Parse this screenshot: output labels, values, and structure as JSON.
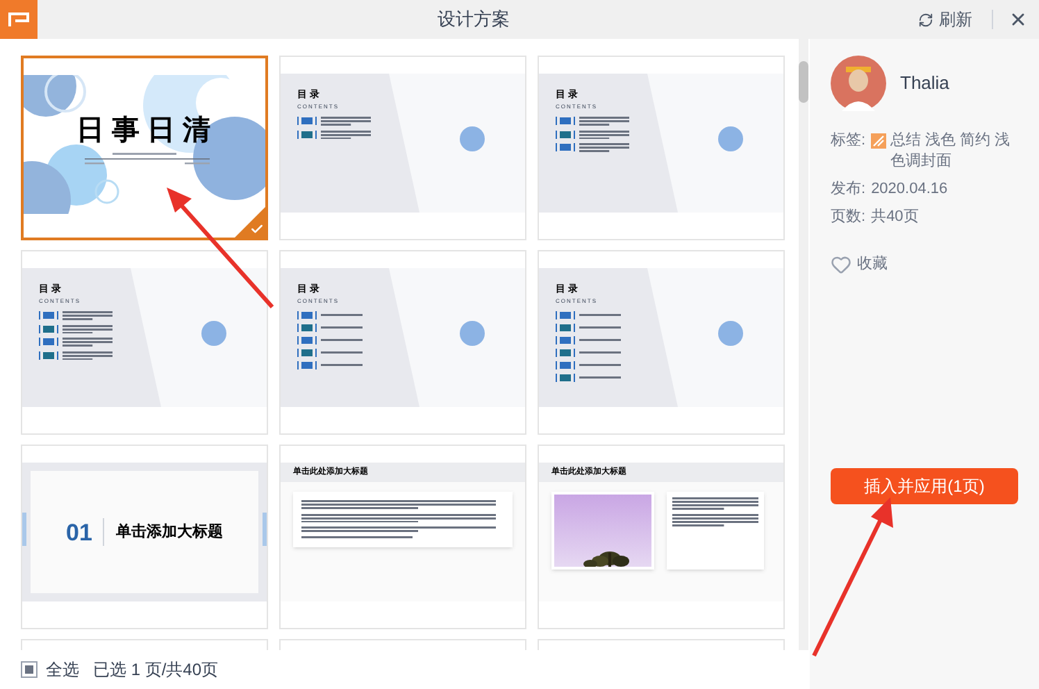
{
  "window": {
    "title": "设计方案",
    "refresh": "刷新"
  },
  "slides": [
    {
      "kind": "cover",
      "selected": true,
      "title": "日 事 日 清"
    },
    {
      "kind": "toc",
      "selected": false,
      "title": "目 录",
      "subtitle": "CONTENTS",
      "entries": [
        {
          "kind": "long"
        },
        {
          "kind": "long"
        }
      ]
    },
    {
      "kind": "toc",
      "selected": false,
      "title": "目 录",
      "subtitle": "CONTENTS",
      "entries": [
        {
          "kind": "long"
        },
        {
          "kind": "long"
        },
        {
          "kind": "long"
        }
      ]
    },
    {
      "kind": "toc",
      "selected": false,
      "title": "目 录",
      "subtitle": "CONTENTS",
      "entries": [
        {
          "kind": "long"
        },
        {
          "kind": "long"
        },
        {
          "kind": "long"
        },
        {
          "kind": "long"
        }
      ]
    },
    {
      "kind": "toc",
      "selected": false,
      "title": "目 录",
      "subtitle": "CONTENTS",
      "entries": [
        {
          "kind": "short"
        },
        {
          "kind": "short"
        },
        {
          "kind": "short"
        },
        {
          "kind": "short"
        },
        {
          "kind": "short"
        }
      ]
    },
    {
      "kind": "toc",
      "selected": false,
      "title": "目 录",
      "subtitle": "CONTENTS",
      "entries": [
        {
          "kind": "short"
        },
        {
          "kind": "short"
        },
        {
          "kind": "short"
        },
        {
          "kind": "short"
        },
        {
          "kind": "short"
        },
        {
          "kind": "short"
        }
      ]
    },
    {
      "kind": "section",
      "selected": false,
      "number": "01",
      "title": "单击添加大标题"
    },
    {
      "kind": "text",
      "selected": false,
      "title": "单击此处添加大标题"
    },
    {
      "selected": false,
      "title": "单击此处添加大标题"
    },
    {
      "kind": "cut-off",
      "selected": false
    },
    {
      "kind": "cut-off",
      "selected": false
    },
    {
      "kind": "cut-off",
      "selected": false
    }
  ],
  "footer": {
    "select_all": {
      "label": "全选",
      "checked": false
    },
    "status": "已选 1 页/共40页"
  },
  "details": {
    "author": "Thalia",
    "fields": [
      {
        "label": "标签:",
        "value": "总结 浅色 简约 浅色调封面",
        "kind": "tags"
      },
      {
        "label": "发布:",
        "value": "2020.04.16",
        "kind": "plain"
      },
      {
        "label": "页数:",
        "value": "共40页",
        "kind": "plain"
      }
    ],
    "favorite": {
      "label": "收藏",
      "on": false
    },
    "apply_button": "插入并应用(1页)"
  }
}
